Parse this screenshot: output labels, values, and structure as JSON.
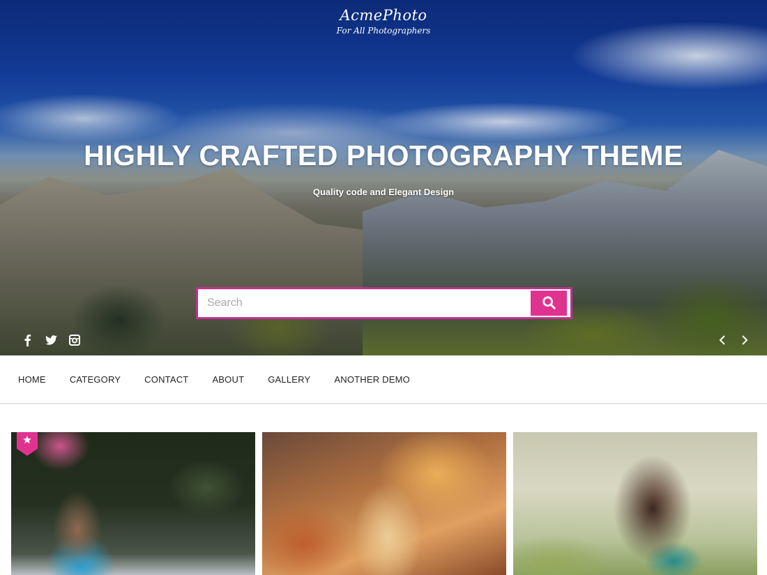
{
  "brand": {
    "title": "AcmePhoto",
    "tagline": "For All Photographers"
  },
  "hero": {
    "title": "HIGHLY CRAFTED PHOTOGRAPHY THEME",
    "subtitle": "Quality code and Elegant Design",
    "search": {
      "placeholder": "Search",
      "value": "",
      "button_icon": "search-icon"
    },
    "social_icons": [
      "facebook-icon",
      "twitter-icon",
      "instagram-icon"
    ],
    "slider_controls": [
      "chevron-left-icon",
      "chevron-right-icon"
    ]
  },
  "nav": {
    "items": [
      {
        "label": "HOME"
      },
      {
        "label": "CATEGORY"
      },
      {
        "label": "CONTACT"
      },
      {
        "label": "ABOUT"
      },
      {
        "label": "GALLERY"
      },
      {
        "label": "ANOTHER DEMO"
      }
    ]
  },
  "gallery": {
    "cards": [
      {
        "featured": true,
        "badge_icon": "star-icon"
      },
      {
        "featured": false
      },
      {
        "featured": false
      }
    ]
  },
  "colors": {
    "accent": "#e0338f",
    "search_border": "#c2308f",
    "nav_text": "#222222"
  }
}
